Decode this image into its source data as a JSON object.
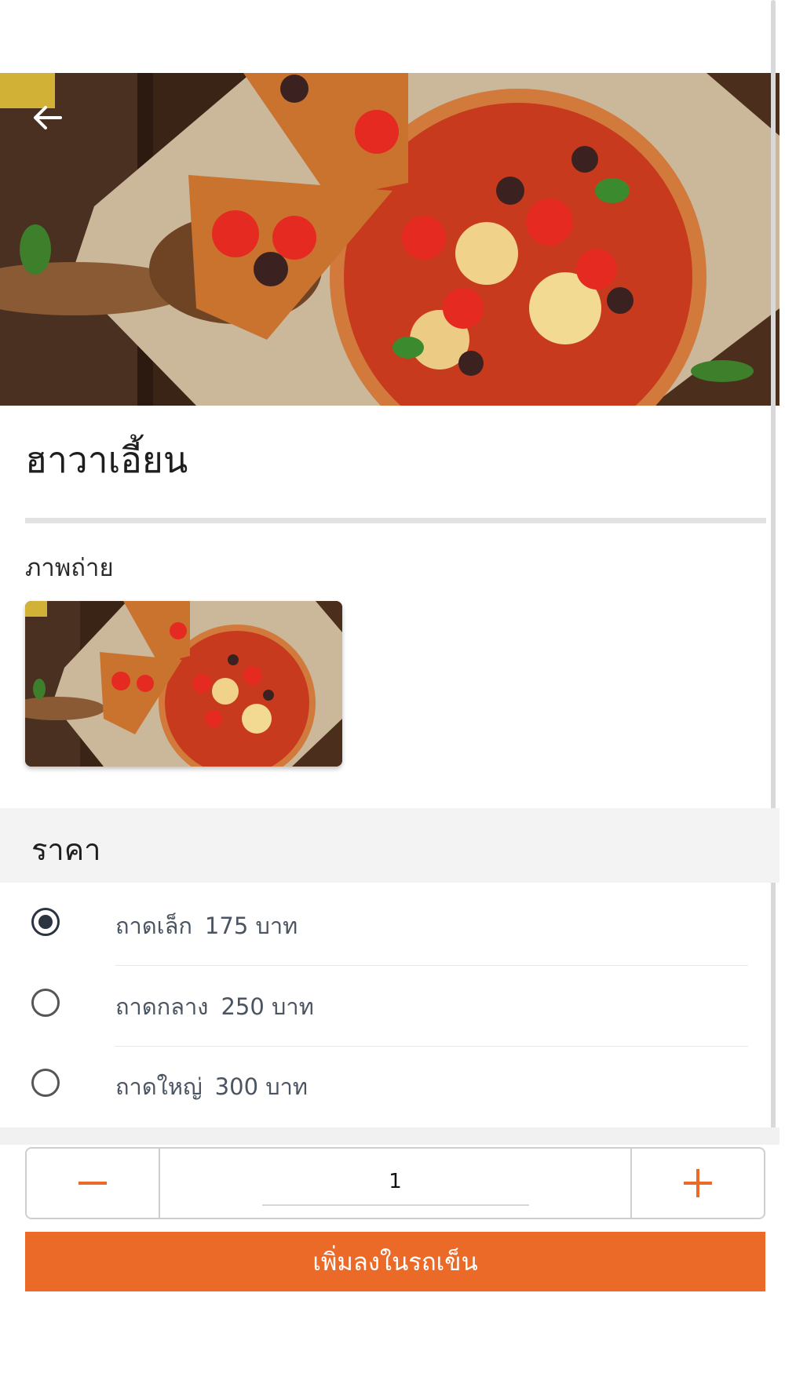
{
  "product": {
    "title": "ฮาวาเอี้ยน"
  },
  "gallery": {
    "label": "ภาพถ่าย"
  },
  "price": {
    "title": "ราคา",
    "options": [
      {
        "size": "ถาดเล็ก",
        "price": "175 บาท",
        "selected": true
      },
      {
        "size": "ถาดกลาง",
        "price": "250 บาท",
        "selected": false
      },
      {
        "size": "ถาดใหญ่",
        "price": "300 บาท",
        "selected": false
      }
    ]
  },
  "quantity": {
    "value": "1"
  },
  "actions": {
    "add_to_cart": "เพิ่มลงในรถเข็น"
  },
  "colors": {
    "accent": "#ec6a28",
    "radio_selected": "#2b3440"
  },
  "icons": {
    "back": "arrow-left-icon",
    "minus": "minus-icon",
    "plus": "plus-icon"
  }
}
